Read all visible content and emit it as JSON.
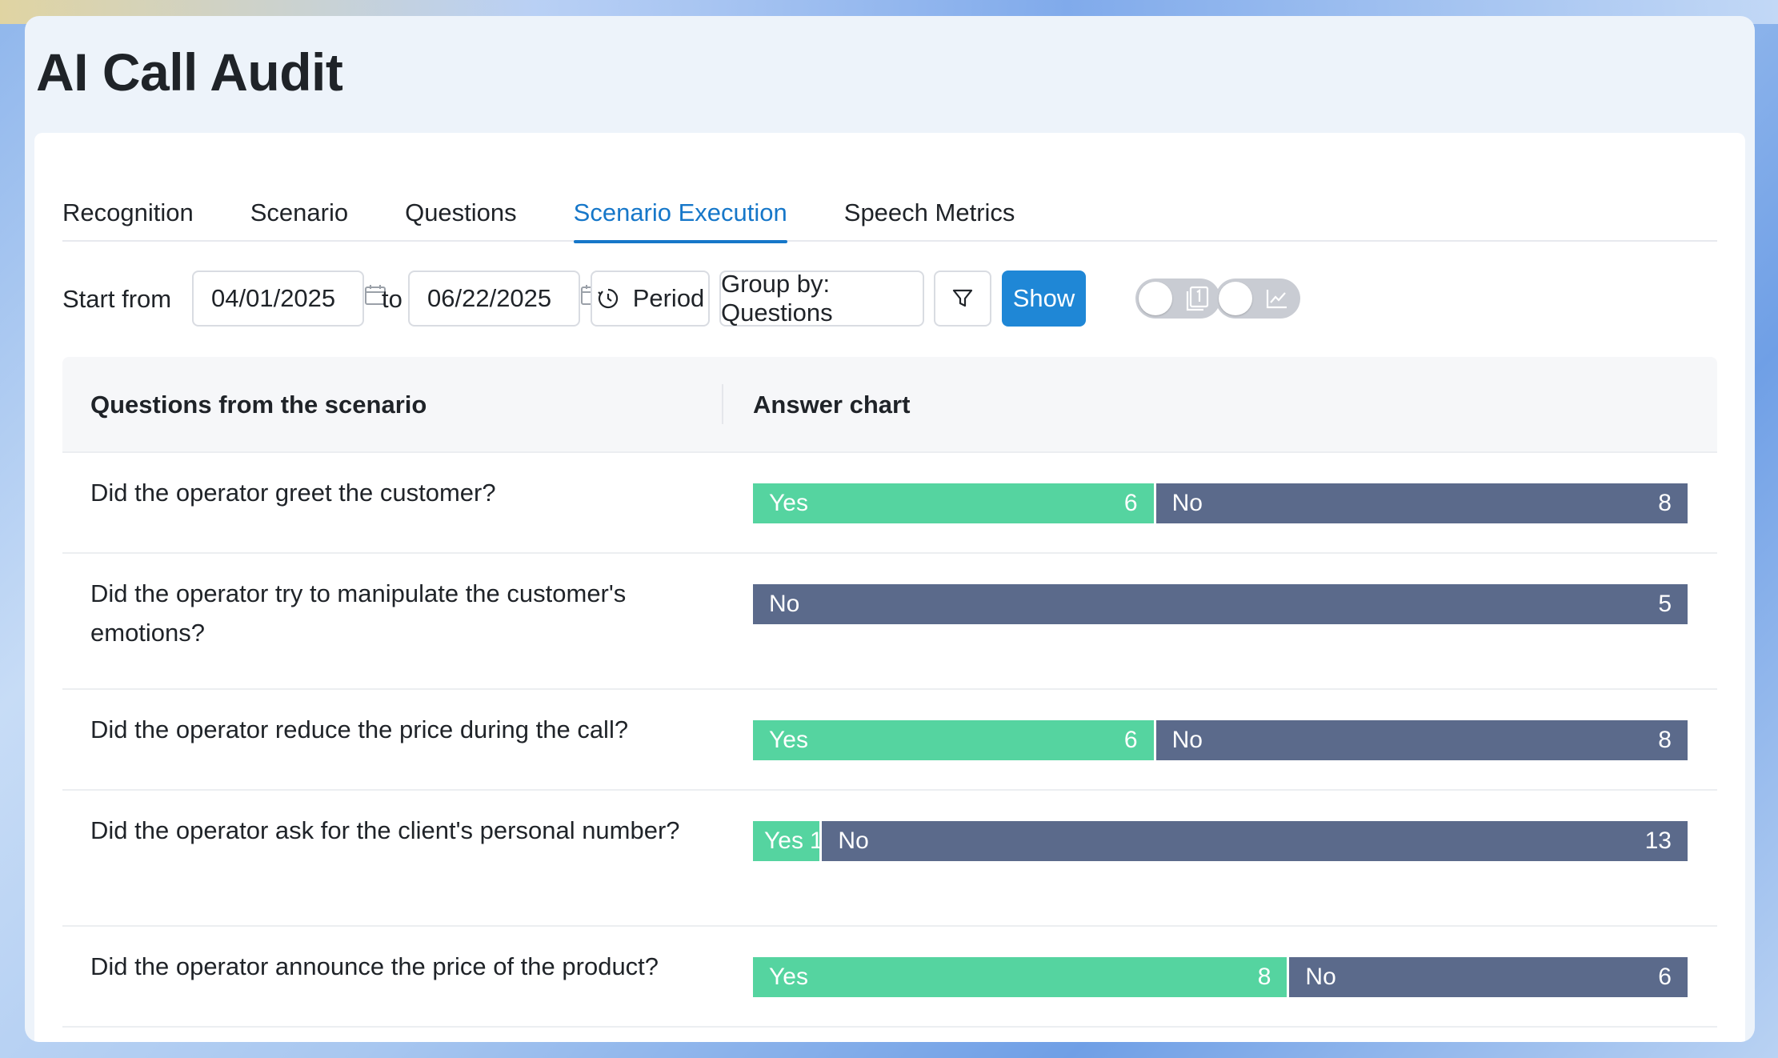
{
  "app": {
    "title": "AI Call Audit"
  },
  "tabs": [
    {
      "label": "Recognition"
    },
    {
      "label": "Scenario"
    },
    {
      "label": "Questions"
    },
    {
      "label": "Scenario Execution",
      "active": true
    },
    {
      "label": "Speech Metrics"
    }
  ],
  "toolbar": {
    "start_label": "Start from",
    "start_date": "04/01/2025",
    "to_label": "to",
    "end_date": "06/22/2025",
    "period_label": "Period",
    "group_by_label": "Group by: Questions",
    "show_label": "Show",
    "toggle_1_icon": "page-number-icon",
    "toggle_2_icon": "line-chart-icon"
  },
  "table": {
    "headers": {
      "questions": "Questions from the scenario",
      "chart": "Answer chart"
    },
    "rows": [
      {
        "question": "Did the operator greet the customer?",
        "answers": [
          {
            "label": "Yes",
            "count": 6
          },
          {
            "label": "No",
            "count": 8
          }
        ]
      },
      {
        "question": "Did the operator try to manipulate the customer's emotions?",
        "answers": [
          {
            "label": "No",
            "count": 5
          }
        ]
      },
      {
        "question": "Did the operator reduce the price during the call?",
        "answers": [
          {
            "label": "Yes",
            "count": 6
          },
          {
            "label": "No",
            "count": 8
          }
        ]
      },
      {
        "question": "Did the operator ask for the client's personal number?",
        "answers": [
          {
            "label": "Yes",
            "count": 1
          },
          {
            "label": "No",
            "count": 13
          }
        ]
      },
      {
        "question": "Did the operator announce the price of the product?",
        "answers": [
          {
            "label": "Yes",
            "count": 8
          },
          {
            "label": "No",
            "count": 6
          }
        ]
      }
    ]
  },
  "colors": {
    "yes": "#55d4a0",
    "no": "#5b6a8b",
    "accent": "#1677c9",
    "primary_button": "#1f87d6"
  }
}
